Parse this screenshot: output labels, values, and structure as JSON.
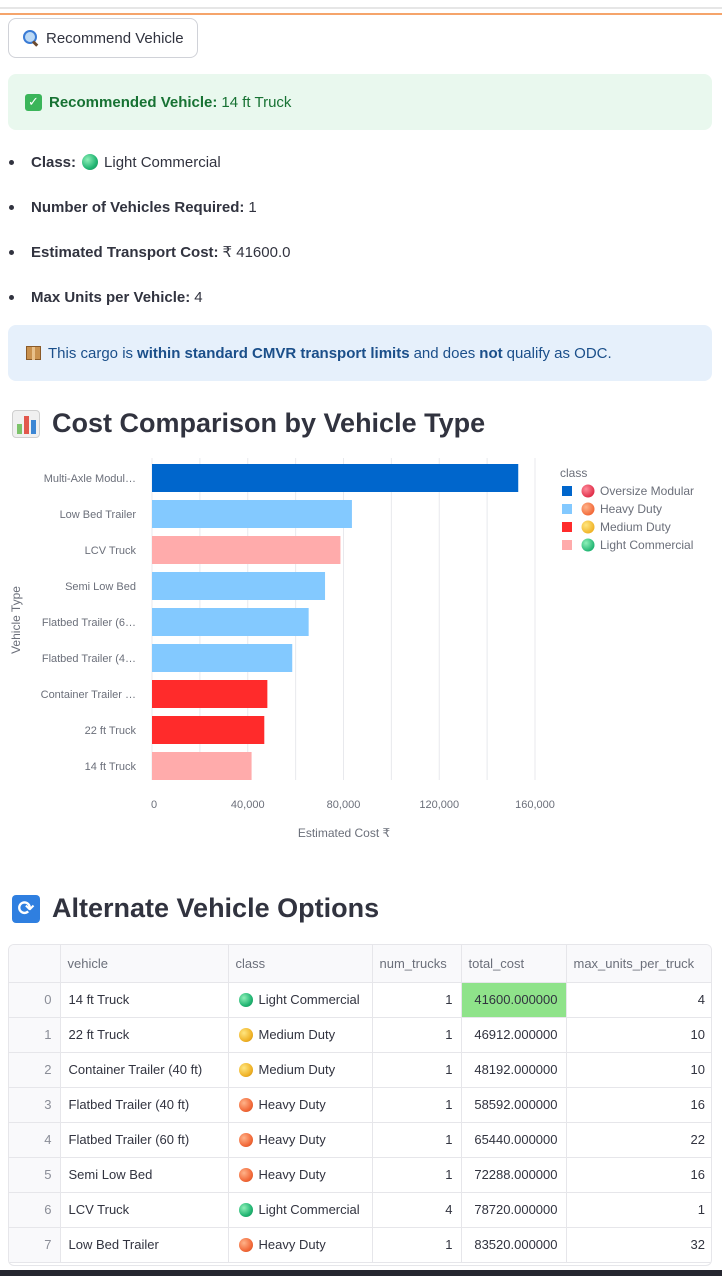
{
  "button": {
    "label": "Recommend Vehicle",
    "icon": "magnifier-icon"
  },
  "success": {
    "label": "Recommended Vehicle:",
    "value": "14 ft Truck",
    "icon": "check-icon"
  },
  "details": [
    {
      "label": "Class:",
      "value": "Light Commercial",
      "ball": "green"
    },
    {
      "label": "Number of Vehicles Required:",
      "value": "1"
    },
    {
      "label": "Estimated Transport Cost:",
      "value": "₹ 41600.0"
    },
    {
      "label": "Max Units per Vehicle:",
      "value": "4"
    }
  ],
  "info": {
    "pre": "This cargo is",
    "bold1": "within standard CMVR transport limits",
    "mid": "and does",
    "bold2": "not",
    "post": "qualify as ODC.",
    "icon": "package-icon"
  },
  "chart_section": {
    "title": "Cost Comparison by Vehicle Type",
    "icon": "bar-chart-icon"
  },
  "chart_data": {
    "type": "bar",
    "orientation": "horizontal",
    "categories": [
      "Multi-Axle Modul…",
      "Low Bed Trailer",
      "LCV Truck",
      "Semi Low Bed",
      "Flatbed Trailer (6…",
      "Flatbed Trailer (4…",
      "Container Trailer …",
      "22 ft Truck",
      "14 ft Truck"
    ],
    "values": [
      153000,
      83520,
      78720,
      72288,
      65440,
      58592,
      48192,
      46912,
      41600
    ],
    "classes": [
      "Oversize Modular",
      "Heavy Duty",
      "Light Commercial",
      "Heavy Duty",
      "Heavy Duty",
      "Heavy Duty",
      "Medium Duty",
      "Medium Duty",
      "Light Commercial"
    ],
    "xlabel": "Estimated Cost ₹",
    "ylabel": "Vehicle Type",
    "xlim": [
      0,
      160000
    ],
    "xticks": [
      0,
      40000,
      80000,
      120000,
      160000
    ],
    "xtick_labels": [
      "0",
      "40,000",
      "80,000",
      "120,000",
      "160,000"
    ],
    "grid": true,
    "legend": {
      "title": "class",
      "placement": "right",
      "entries": [
        {
          "name": "Oversize Modular",
          "color": "#0066cc",
          "ball": "red"
        },
        {
          "name": "Heavy Duty",
          "color": "#83c9ff",
          "ball": "orange"
        },
        {
          "name": "Medium Duty",
          "color": "#ff2b2b",
          "ball": "yellow"
        },
        {
          "name": "Light Commercial",
          "color": "#ffabab",
          "ball": "green"
        }
      ]
    }
  },
  "table_section": {
    "title": "Alternate Vehicle Options",
    "icon": "refresh-icon"
  },
  "table": {
    "columns": [
      "",
      "vehicle",
      "class",
      "num_trucks",
      "total_cost",
      "max_units_per_truck"
    ],
    "rows": [
      {
        "idx": "0",
        "vehicle": "14 ft Truck",
        "class": "Light Commercial",
        "ball": "green",
        "num_trucks": "1",
        "total_cost": "41600.000000",
        "max_units": "4",
        "highlight": true
      },
      {
        "idx": "1",
        "vehicle": "22 ft Truck",
        "class": "Medium Duty",
        "ball": "yellow",
        "num_trucks": "1",
        "total_cost": "46912.000000",
        "max_units": "10"
      },
      {
        "idx": "2",
        "vehicle": "Container Trailer (40 ft)",
        "class": "Medium Duty",
        "ball": "yellow",
        "num_trucks": "1",
        "total_cost": "48192.000000",
        "max_units": "10"
      },
      {
        "idx": "3",
        "vehicle": "Flatbed Trailer (40 ft)",
        "class": "Heavy Duty",
        "ball": "orange",
        "num_trucks": "1",
        "total_cost": "58592.000000",
        "max_units": "16"
      },
      {
        "idx": "4",
        "vehicle": "Flatbed Trailer (60 ft)",
        "class": "Heavy Duty",
        "ball": "orange",
        "num_trucks": "1",
        "total_cost": "65440.000000",
        "max_units": "22"
      },
      {
        "idx": "5",
        "vehicle": "Semi Low Bed",
        "class": "Heavy Duty",
        "ball": "orange",
        "num_trucks": "1",
        "total_cost": "72288.000000",
        "max_units": "16"
      },
      {
        "idx": "6",
        "vehicle": "LCV Truck",
        "class": "Light Commercial",
        "ball": "green",
        "num_trucks": "4",
        "total_cost": "78720.000000",
        "max_units": "1"
      },
      {
        "idx": "7",
        "vehicle": "Low Bed Trailer",
        "class": "Heavy Duty",
        "ball": "orange",
        "num_trucks": "1",
        "total_cost": "83520.000000",
        "max_units": "32"
      }
    ]
  }
}
